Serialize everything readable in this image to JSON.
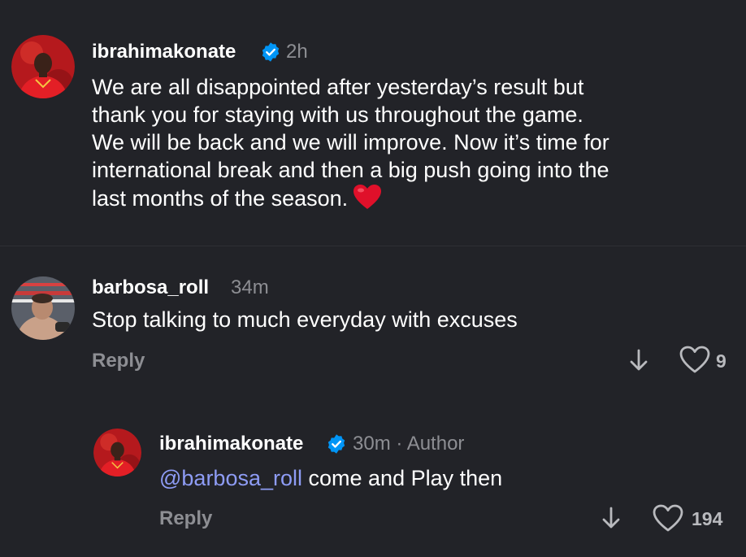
{
  "post": {
    "username": "ibrahimakonate",
    "time": "2h",
    "caption_lines": [
      "We are all disappointed after yesterday’s result but",
      "thank you for staying with us throughout the game.",
      "We will be back and we will improve. Now it’s time for",
      "international break and then a big push going into the",
      "last months of the season."
    ],
    "caption_emoji": "red-heart-emoji"
  },
  "comments": [
    {
      "username": "barbosa_roll",
      "time": "34m",
      "text": "Stop talking to much everyday with excuses",
      "reply_label": "Reply",
      "like_count": "9"
    }
  ],
  "replies": [
    {
      "username": "ibrahimakonate",
      "meta": "30m · Author",
      "mention": "@barbosa_roll",
      "text": " come and Play then",
      "reply_label": "Reply",
      "like_count": "194"
    }
  ],
  "icons": {
    "verified": "verified-badge-icon",
    "down_arrow": "down-arrow-icon",
    "heart": "heart-outline-icon"
  },
  "colors": {
    "background": "#222328",
    "text": "#ffffff",
    "muted": "#8d8e93",
    "mention": "#8e9cf5",
    "verified": "#0095f6",
    "emoji_heart": "#e0102a"
  }
}
